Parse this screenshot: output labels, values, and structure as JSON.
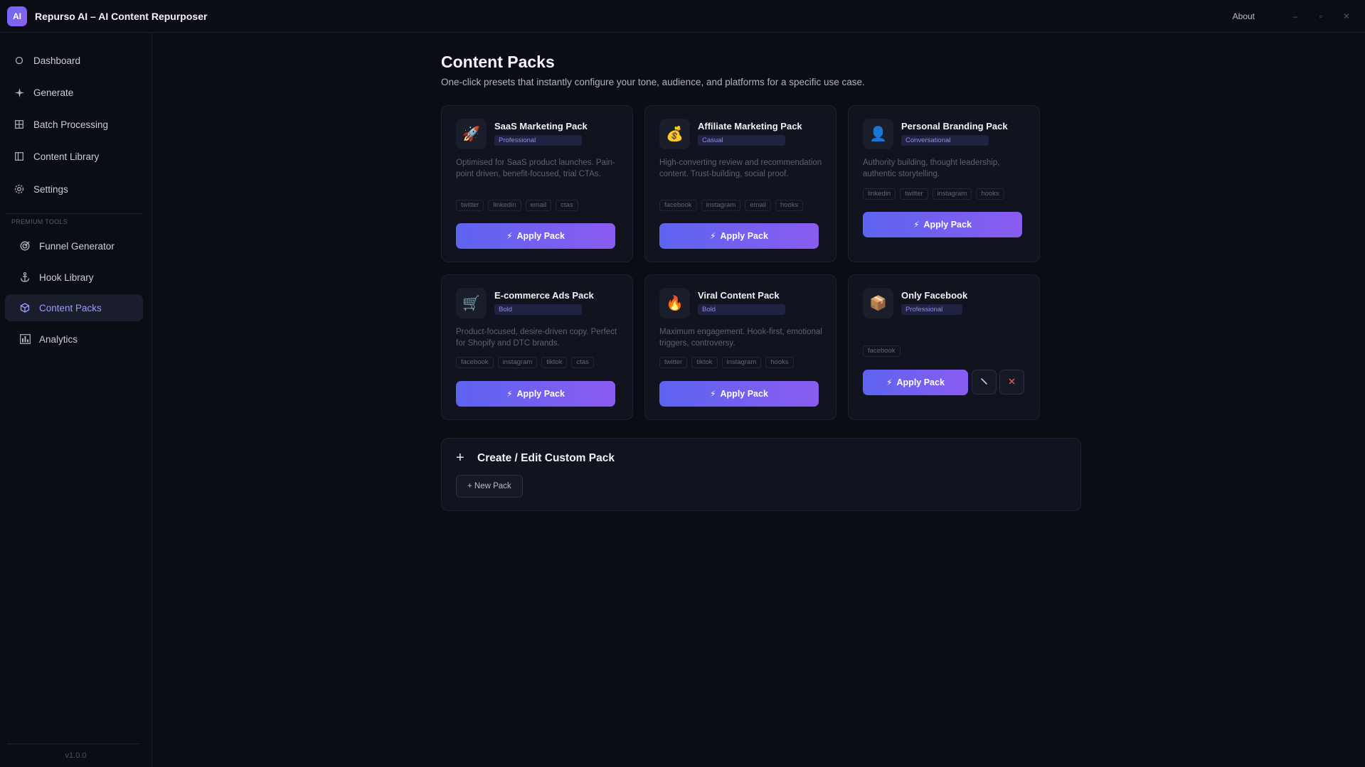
{
  "app": {
    "logo_text": "AI",
    "title": "Repurso AI – AI Content Repurposer",
    "about_label": "About",
    "window_controls": [
      "–",
      "▫",
      "✕"
    ]
  },
  "sidebar": {
    "items": [
      {
        "label": "Dashboard",
        "icon": "circle-icon"
      },
      {
        "label": "Generate",
        "icon": "sparkle-icon"
      },
      {
        "label": "Batch Processing",
        "icon": "grid-icon"
      },
      {
        "label": "Content Library",
        "icon": "library-icon"
      },
      {
        "label": "Settings",
        "icon": "gear-icon"
      }
    ],
    "premium_label": "PREMIUM TOOLS",
    "premium_items": [
      {
        "label": "Funnel Generator",
        "icon": "target-icon"
      },
      {
        "label": "Hook Library",
        "icon": "anchor-icon"
      },
      {
        "label": "Content Packs",
        "icon": "box-icon",
        "active": true
      },
      {
        "label": "Analytics",
        "icon": "bar-chart-icon"
      }
    ],
    "version": "v1.0.0"
  },
  "main": {
    "title": "Content Packs",
    "subtitle": "One-click presets that instantly configure your tone, audience, and platforms for a specific use case.",
    "packs": [
      {
        "name": "SaaS Marketing Pack",
        "tone": "Professional",
        "emoji": "🚀",
        "description": "Optimised for SaaS product launches. Pain-point driven, benefit-focused, trial CTAs.",
        "tags": [
          "twitter",
          "linkedin",
          "email",
          "ctas"
        ],
        "apply_label": "Apply Pack"
      },
      {
        "name": "Affiliate Marketing Pack",
        "tone": "Casual",
        "emoji": "💰",
        "description": "High-converting review and recommendation content. Trust-building, social proof.",
        "tags": [
          "facebook",
          "instagram",
          "email",
          "hooks"
        ],
        "apply_label": "Apply Pack"
      },
      {
        "name": "Personal Branding Pack",
        "tone": "Conversational",
        "emoji": "👤",
        "description": "Authority building, thought leadership, authentic storytelling.",
        "tags": [
          "linkedin",
          "twitter",
          "instagram",
          "hooks"
        ],
        "apply_label": "Apply Pack"
      },
      {
        "name": "E-commerce Ads Pack",
        "tone": "Bold",
        "emoji": "🛒",
        "description": "Product-focused, desire-driven copy. Perfect for Shopify and DTC brands.",
        "tags": [
          "facebook",
          "instagram",
          "tiktok",
          "ctas"
        ],
        "apply_label": "Apply Pack"
      },
      {
        "name": "Viral Content Pack",
        "tone": "Bold",
        "emoji": "🔥",
        "description": "Maximum engagement. Hook-first, emotional triggers, controversy.",
        "tags": [
          "twitter",
          "tiktok",
          "instagram",
          "hooks"
        ],
        "apply_label": "Apply Pack"
      },
      {
        "name": "Only Facebook",
        "tone": "Professional",
        "emoji": "📦",
        "description": "",
        "tags": [
          "facebook"
        ],
        "apply_label": "Apply Pack",
        "custom": true
      }
    ],
    "custom_panel": {
      "title": "Create / Edit Custom Pack",
      "new_pack_label": "+ New Pack"
    }
  },
  "colors": {
    "accent_start": "#5d64f0",
    "accent_end": "#8a5cf1",
    "active_nav_text": "#9d9cff",
    "delete_red": "#e05757"
  }
}
